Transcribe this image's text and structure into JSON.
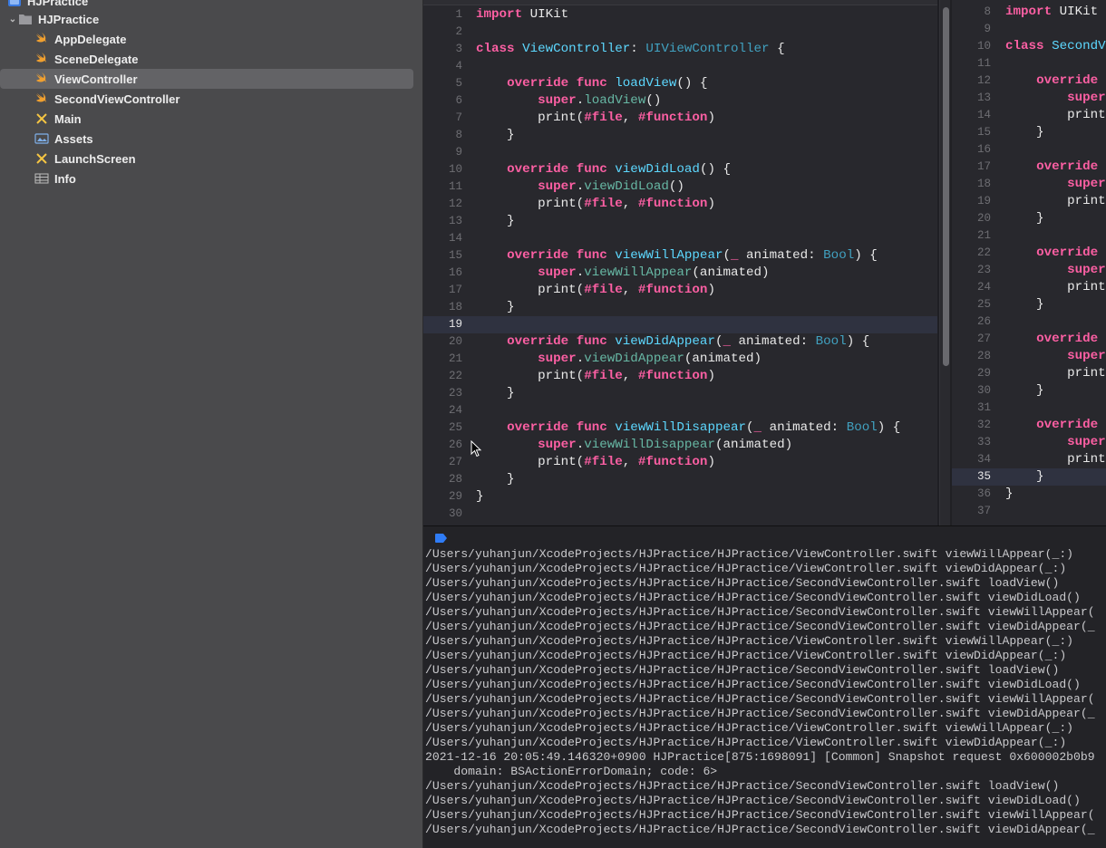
{
  "navigator": {
    "project_name": "HJPractice",
    "group_name": "HJPractice",
    "items": [
      {
        "label": "AppDelegate",
        "icon": "swift-file-icon"
      },
      {
        "label": "SceneDelegate",
        "icon": "swift-file-icon"
      },
      {
        "label": "ViewController",
        "icon": "swift-file-icon",
        "selected": true
      },
      {
        "label": "SecondViewController",
        "icon": "swift-file-icon"
      },
      {
        "label": "Main",
        "icon": "storyboard-icon"
      },
      {
        "label": "Assets",
        "icon": "asset-catalog-icon"
      },
      {
        "label": "LaunchScreen",
        "icon": "storyboard-icon"
      },
      {
        "label": "Info",
        "icon": "plist-table-icon"
      }
    ]
  },
  "colors": {
    "keyword": "#fc5fa3",
    "type": "#5dd8ff",
    "class_ref": "#41a1c0",
    "function_call": "#67b7a4",
    "macro": "#a167e6",
    "swift_icon": "#f0a030",
    "storyboard_icon": "#f5c542",
    "console_accent": "#2f7cf6"
  },
  "editor_left": {
    "current_line": 19,
    "lines": [
      {
        "n": "1",
        "segs": [
          [
            "k",
            "import"
          ],
          [
            "p",
            " UIKit"
          ]
        ]
      },
      {
        "n": "2",
        "segs": []
      },
      {
        "n": "3",
        "segs": [
          [
            "k",
            "class"
          ],
          [
            "p",
            " "
          ],
          [
            "t",
            "ViewController"
          ],
          [
            "p",
            ": "
          ],
          [
            "c",
            "UIViewController"
          ],
          [
            "p",
            " {"
          ]
        ]
      },
      {
        "n": "4",
        "segs": []
      },
      {
        "n": "5",
        "segs": [
          [
            "p",
            "    "
          ],
          [
            "k",
            "override"
          ],
          [
            "p",
            " "
          ],
          [
            "k",
            "func"
          ],
          [
            "p",
            " "
          ],
          [
            "t",
            "loadView"
          ],
          [
            "p",
            "() {"
          ]
        ]
      },
      {
        "n": "6",
        "segs": [
          [
            "p",
            "        "
          ],
          [
            "k",
            "super"
          ],
          [
            "p",
            "."
          ],
          [
            "f",
            "loadView"
          ],
          [
            "p",
            "()"
          ]
        ]
      },
      {
        "n": "7",
        "segs": [
          [
            "p",
            "        print("
          ],
          [
            "k",
            "#file"
          ],
          [
            "p",
            ", "
          ],
          [
            "k",
            "#function"
          ],
          [
            "p",
            ")"
          ]
        ]
      },
      {
        "n": "8",
        "segs": [
          [
            "p",
            "    }"
          ]
        ]
      },
      {
        "n": "9",
        "segs": []
      },
      {
        "n": "10",
        "segs": [
          [
            "p",
            "    "
          ],
          [
            "k",
            "override"
          ],
          [
            "p",
            " "
          ],
          [
            "k",
            "func"
          ],
          [
            "p",
            " "
          ],
          [
            "t",
            "viewDidLoad"
          ],
          [
            "p",
            "() {"
          ]
        ]
      },
      {
        "n": "11",
        "segs": [
          [
            "p",
            "        "
          ],
          [
            "k",
            "super"
          ],
          [
            "p",
            "."
          ],
          [
            "f",
            "viewDidLoad"
          ],
          [
            "p",
            "()"
          ]
        ]
      },
      {
        "n": "12",
        "segs": [
          [
            "p",
            "        print("
          ],
          [
            "k",
            "#file"
          ],
          [
            "p",
            ", "
          ],
          [
            "k",
            "#function"
          ],
          [
            "p",
            ")"
          ]
        ]
      },
      {
        "n": "13",
        "segs": [
          [
            "p",
            "    }"
          ]
        ]
      },
      {
        "n": "14",
        "segs": []
      },
      {
        "n": "15",
        "segs": [
          [
            "p",
            "    "
          ],
          [
            "k",
            "override"
          ],
          [
            "p",
            " "
          ],
          [
            "k",
            "func"
          ],
          [
            "p",
            " "
          ],
          [
            "t",
            "viewWillAppear"
          ],
          [
            "p",
            "("
          ],
          [
            "k",
            "_"
          ],
          [
            "p",
            " animated: "
          ],
          [
            "c",
            "Bool"
          ],
          [
            "p",
            ") {"
          ]
        ]
      },
      {
        "n": "16",
        "segs": [
          [
            "p",
            "        "
          ],
          [
            "k",
            "super"
          ],
          [
            "p",
            "."
          ],
          [
            "f",
            "viewWillAppear"
          ],
          [
            "p",
            "(animated)"
          ]
        ]
      },
      {
        "n": "17",
        "segs": [
          [
            "p",
            "        print("
          ],
          [
            "k",
            "#file"
          ],
          [
            "p",
            ", "
          ],
          [
            "k",
            "#function"
          ],
          [
            "p",
            ")"
          ]
        ]
      },
      {
        "n": "18",
        "segs": [
          [
            "p",
            "    }"
          ]
        ]
      },
      {
        "n": "19",
        "segs": []
      },
      {
        "n": "20",
        "segs": [
          [
            "p",
            "    "
          ],
          [
            "k",
            "override"
          ],
          [
            "p",
            " "
          ],
          [
            "k",
            "func"
          ],
          [
            "p",
            " "
          ],
          [
            "t",
            "viewDidAppear"
          ],
          [
            "p",
            "("
          ],
          [
            "k",
            "_"
          ],
          [
            "p",
            " animated: "
          ],
          [
            "c",
            "Bool"
          ],
          [
            "p",
            ") {"
          ]
        ]
      },
      {
        "n": "21",
        "segs": [
          [
            "p",
            "        "
          ],
          [
            "k",
            "super"
          ],
          [
            "p",
            "."
          ],
          [
            "f",
            "viewDidAppear"
          ],
          [
            "p",
            "(animated)"
          ]
        ]
      },
      {
        "n": "22",
        "segs": [
          [
            "p",
            "        print("
          ],
          [
            "k",
            "#file"
          ],
          [
            "p",
            ", "
          ],
          [
            "k",
            "#function"
          ],
          [
            "p",
            ")"
          ]
        ]
      },
      {
        "n": "23",
        "segs": [
          [
            "p",
            "    }"
          ]
        ]
      },
      {
        "n": "24",
        "segs": []
      },
      {
        "n": "25",
        "segs": [
          [
            "p",
            "    "
          ],
          [
            "k",
            "override"
          ],
          [
            "p",
            " "
          ],
          [
            "k",
            "func"
          ],
          [
            "p",
            " "
          ],
          [
            "t",
            "viewWillDisappear"
          ],
          [
            "p",
            "("
          ],
          [
            "k",
            "_"
          ],
          [
            "p",
            " animated: "
          ],
          [
            "c",
            "Bool"
          ],
          [
            "p",
            ") {"
          ]
        ]
      },
      {
        "n": "26",
        "segs": [
          [
            "p",
            "        "
          ],
          [
            "k",
            "super"
          ],
          [
            "p",
            "."
          ],
          [
            "f",
            "viewWillDisappear"
          ],
          [
            "p",
            "(animated)"
          ]
        ]
      },
      {
        "n": "27",
        "segs": [
          [
            "p",
            "        print("
          ],
          [
            "k",
            "#file"
          ],
          [
            "p",
            ", "
          ],
          [
            "k",
            "#function"
          ],
          [
            "p",
            ")"
          ]
        ]
      },
      {
        "n": "28",
        "segs": [
          [
            "p",
            "    }"
          ]
        ]
      },
      {
        "n": "29",
        "segs": [
          [
            "p",
            "}"
          ]
        ]
      },
      {
        "n": "30",
        "segs": []
      }
    ]
  },
  "editor_right": {
    "current_line": 35,
    "lines": [
      {
        "n": "8",
        "segs": [
          [
            "k",
            "import"
          ],
          [
            "p",
            " UIKit"
          ]
        ]
      },
      {
        "n": "9",
        "segs": []
      },
      {
        "n": "10",
        "segs": [
          [
            "k",
            "class"
          ],
          [
            "p",
            " "
          ],
          [
            "t",
            "SecondV"
          ]
        ]
      },
      {
        "n": "11",
        "segs": []
      },
      {
        "n": "12",
        "segs": [
          [
            "p",
            "    "
          ],
          [
            "k",
            "override"
          ]
        ]
      },
      {
        "n": "13",
        "segs": [
          [
            "p",
            "        "
          ],
          [
            "k",
            "super"
          ]
        ]
      },
      {
        "n": "14",
        "segs": [
          [
            "p",
            "        print"
          ]
        ]
      },
      {
        "n": "15",
        "segs": [
          [
            "p",
            "    }"
          ]
        ]
      },
      {
        "n": "16",
        "segs": []
      },
      {
        "n": "17",
        "segs": [
          [
            "p",
            "    "
          ],
          [
            "k",
            "override"
          ]
        ]
      },
      {
        "n": "18",
        "segs": [
          [
            "p",
            "        "
          ],
          [
            "k",
            "super"
          ]
        ]
      },
      {
        "n": "19",
        "segs": [
          [
            "p",
            "        print"
          ]
        ]
      },
      {
        "n": "20",
        "segs": [
          [
            "p",
            "    }"
          ]
        ]
      },
      {
        "n": "21",
        "segs": []
      },
      {
        "n": "22",
        "segs": [
          [
            "p",
            "    "
          ],
          [
            "k",
            "override"
          ]
        ]
      },
      {
        "n": "23",
        "segs": [
          [
            "p",
            "        "
          ],
          [
            "k",
            "super"
          ]
        ]
      },
      {
        "n": "24",
        "segs": [
          [
            "p",
            "        print"
          ]
        ]
      },
      {
        "n": "25",
        "segs": [
          [
            "p",
            "    }"
          ]
        ]
      },
      {
        "n": "26",
        "segs": []
      },
      {
        "n": "27",
        "segs": [
          [
            "p",
            "    "
          ],
          [
            "k",
            "override"
          ]
        ]
      },
      {
        "n": "28",
        "segs": [
          [
            "p",
            "        "
          ],
          [
            "k",
            "super"
          ]
        ]
      },
      {
        "n": "29",
        "segs": [
          [
            "p",
            "        print"
          ]
        ]
      },
      {
        "n": "30",
        "segs": [
          [
            "p",
            "    }"
          ]
        ]
      },
      {
        "n": "31",
        "segs": []
      },
      {
        "n": "32",
        "segs": [
          [
            "p",
            "    "
          ],
          [
            "k",
            "override"
          ]
        ]
      },
      {
        "n": "33",
        "segs": [
          [
            "p",
            "        "
          ],
          [
            "k",
            "super"
          ]
        ]
      },
      {
        "n": "34",
        "segs": [
          [
            "p",
            "        print"
          ]
        ]
      },
      {
        "n": "35",
        "segs": [
          [
            "p",
            "    }"
          ]
        ]
      },
      {
        "n": "36",
        "segs": [
          [
            "p",
            "}"
          ]
        ]
      },
      {
        "n": "37",
        "segs": []
      }
    ]
  },
  "console": {
    "lines": [
      "/Users/yuhanjun/XcodeProjects/HJPractice/HJPractice/ViewController.swift viewWillAppear(_:)",
      "/Users/yuhanjun/XcodeProjects/HJPractice/HJPractice/ViewController.swift viewDidAppear(_:)",
      "/Users/yuhanjun/XcodeProjects/HJPractice/HJPractice/SecondViewController.swift loadView()",
      "/Users/yuhanjun/XcodeProjects/HJPractice/HJPractice/SecondViewController.swift viewDidLoad()",
      "/Users/yuhanjun/XcodeProjects/HJPractice/HJPractice/SecondViewController.swift viewWillAppear(",
      "/Users/yuhanjun/XcodeProjects/HJPractice/HJPractice/SecondViewController.swift viewDidAppear(_",
      "/Users/yuhanjun/XcodeProjects/HJPractice/HJPractice/ViewController.swift viewWillAppear(_:)",
      "/Users/yuhanjun/XcodeProjects/HJPractice/HJPractice/ViewController.swift viewDidAppear(_:)",
      "/Users/yuhanjun/XcodeProjects/HJPractice/HJPractice/SecondViewController.swift loadView()",
      "/Users/yuhanjun/XcodeProjects/HJPractice/HJPractice/SecondViewController.swift viewDidLoad()",
      "/Users/yuhanjun/XcodeProjects/HJPractice/HJPractice/SecondViewController.swift viewWillAppear(",
      "/Users/yuhanjun/XcodeProjects/HJPractice/HJPractice/SecondViewController.swift viewDidAppear(_",
      "/Users/yuhanjun/XcodeProjects/HJPractice/HJPractice/ViewController.swift viewWillAppear(_:)",
      "/Users/yuhanjun/XcodeProjects/HJPractice/HJPractice/ViewController.swift viewDidAppear(_:)",
      "2021-12-16 20:05:49.146320+0900 HJPractice[875:1698091] [Common] Snapshot request 0x600002b0b9",
      "    domain: BSActionErrorDomain; code: 6>",
      "/Users/yuhanjun/XcodeProjects/HJPractice/HJPractice/SecondViewController.swift loadView()",
      "/Users/yuhanjun/XcodeProjects/HJPractice/HJPractice/SecondViewController.swift viewDidLoad()",
      "/Users/yuhanjun/XcodeProjects/HJPractice/HJPractice/SecondViewController.swift viewWillAppear(",
      "/Users/yuhanjun/XcodeProjects/HJPractice/HJPractice/SecondViewController.swift viewDidAppear(_"
    ]
  }
}
